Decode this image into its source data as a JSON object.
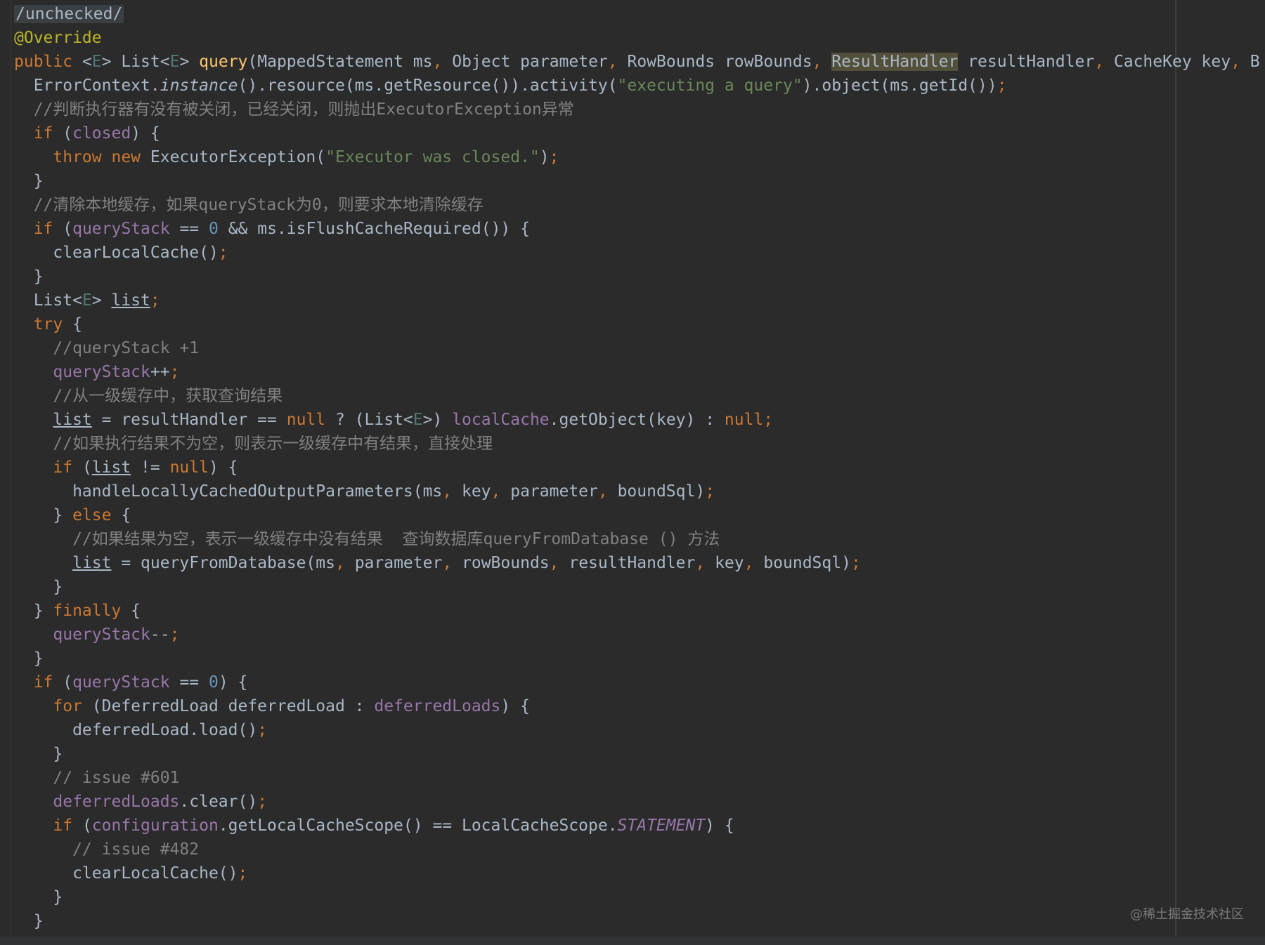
{
  "editor": {
    "watermark": "@稀土掘金技术社区",
    "colors": {
      "background": "#2b2b2b",
      "keyword": "#cc7832",
      "annotation": "#bbb529",
      "string": "#6a8759",
      "number": "#6897bb",
      "comment": "#808080",
      "field": "#9876aa",
      "method": "#ffc66d",
      "plain": "#a9b7c6"
    },
    "lines": [
      [
        {
          "t": "/unchecked/",
          "c": "deco-box"
        }
      ],
      [
        {
          "t": "@Override",
          "c": "ann"
        }
      ],
      [
        {
          "t": "public ",
          "c": "kw"
        },
        {
          "t": "<",
          "c": "plain"
        },
        {
          "t": "E",
          "c": "gen"
        },
        {
          "t": "> List<",
          "c": "plain"
        },
        {
          "t": "E",
          "c": "gen"
        },
        {
          "t": "> ",
          "c": "plain"
        },
        {
          "t": "query",
          "c": "mth"
        },
        {
          "t": "(MappedStatement ms",
          "c": "plain"
        },
        {
          "t": ", ",
          "c": "kw"
        },
        {
          "t": "Object parameter",
          "c": "plain"
        },
        {
          "t": ", ",
          "c": "kw"
        },
        {
          "t": "RowBounds rowBounds",
          "c": "plain"
        },
        {
          "t": ", ",
          "c": "kw"
        },
        {
          "t": "ResultHandler",
          "c": "plain hl"
        },
        {
          "t": " resultHandler",
          "c": "plain"
        },
        {
          "t": ", ",
          "c": "kw"
        },
        {
          "t": "CacheKey key",
          "c": "plain"
        },
        {
          "t": ", ",
          "c": "kw"
        },
        {
          "t": "B",
          "c": "plain"
        }
      ],
      [
        {
          "t": "  ErrorContext.",
          "c": "plain"
        },
        {
          "t": "instance",
          "c": "plain it"
        },
        {
          "t": "().resource(ms.getResource()).activity(",
          "c": "plain"
        },
        {
          "t": "\"executing a query\"",
          "c": "str"
        },
        {
          "t": ").object(ms.getId())",
          "c": "plain"
        },
        {
          "t": ";",
          "c": "kw"
        }
      ],
      [
        {
          "t": "  //判断执行器有没有被关闭，已经关闭，则抛出ExecutorException异常",
          "c": "cmt"
        }
      ],
      [
        {
          "t": "  if ",
          "c": "kw"
        },
        {
          "t": "(",
          "c": "plain"
        },
        {
          "t": "closed",
          "c": "fld"
        },
        {
          "t": ") {",
          "c": "plain"
        }
      ],
      [
        {
          "t": "    throw new ",
          "c": "kw"
        },
        {
          "t": "ExecutorException(",
          "c": "plain"
        },
        {
          "t": "\"Executor was closed.\"",
          "c": "str"
        },
        {
          "t": ")",
          "c": "plain"
        },
        {
          "t": ";",
          "c": "kw"
        }
      ],
      [
        {
          "t": "  }",
          "c": "plain"
        }
      ],
      [
        {
          "t": "  //清除本地缓存，如果queryStack为0，则要求本地清除缓存",
          "c": "cmt"
        }
      ],
      [
        {
          "t": "  if ",
          "c": "kw"
        },
        {
          "t": "(",
          "c": "plain"
        },
        {
          "t": "queryStack",
          "c": "fld"
        },
        {
          "t": " == ",
          "c": "plain"
        },
        {
          "t": "0",
          "c": "num"
        },
        {
          "t": " && ms.isFlushCacheRequired()) {",
          "c": "plain"
        }
      ],
      [
        {
          "t": "    clearLocalCache()",
          "c": "plain"
        },
        {
          "t": ";",
          "c": "kw"
        }
      ],
      [
        {
          "t": "  }",
          "c": "plain"
        }
      ],
      [
        {
          "t": "  List<",
          "c": "plain"
        },
        {
          "t": "E",
          "c": "gen"
        },
        {
          "t": "> ",
          "c": "plain"
        },
        {
          "t": "list",
          "c": "plain ul"
        },
        {
          "t": ";",
          "c": "kw"
        }
      ],
      [
        {
          "t": "  try ",
          "c": "kw"
        },
        {
          "t": "{",
          "c": "plain"
        }
      ],
      [
        {
          "t": "    //queryStack +1",
          "c": "cmt"
        }
      ],
      [
        {
          "t": "    queryStack",
          "c": "fld"
        },
        {
          "t": "++",
          "c": "plain"
        },
        {
          "t": ";",
          "c": "kw"
        }
      ],
      [
        {
          "t": "    //从一级缓存中，获取查询结果",
          "c": "cmt"
        }
      ],
      [
        {
          "t": "    ",
          "c": "plain"
        },
        {
          "t": "list",
          "c": "plain ul"
        },
        {
          "t": " = resultHandler == ",
          "c": "plain"
        },
        {
          "t": "null ",
          "c": "kw"
        },
        {
          "t": "? (List<",
          "c": "plain"
        },
        {
          "t": "E",
          "c": "gen"
        },
        {
          "t": ">) ",
          "c": "plain"
        },
        {
          "t": "localCache",
          "c": "fld"
        },
        {
          "t": ".getObject(key) : ",
          "c": "plain"
        },
        {
          "t": "null;",
          "c": "kw"
        }
      ],
      [
        {
          "t": "    //如果执行结果不为空，则表示一级缓存中有结果，直接处理",
          "c": "cmt"
        }
      ],
      [
        {
          "t": "    if ",
          "c": "kw"
        },
        {
          "t": "(",
          "c": "plain"
        },
        {
          "t": "list",
          "c": "plain ul"
        },
        {
          "t": " != ",
          "c": "plain"
        },
        {
          "t": "null",
          "c": "kw"
        },
        {
          "t": ") {",
          "c": "plain"
        }
      ],
      [
        {
          "t": "      handleLocallyCachedOutputParameters(ms",
          "c": "plain"
        },
        {
          "t": ", ",
          "c": "kw"
        },
        {
          "t": "key",
          "c": "plain"
        },
        {
          "t": ", ",
          "c": "kw"
        },
        {
          "t": "parameter",
          "c": "plain"
        },
        {
          "t": ", ",
          "c": "kw"
        },
        {
          "t": "boundSql)",
          "c": "plain"
        },
        {
          "t": ";",
          "c": "kw"
        }
      ],
      [
        {
          "t": "    } ",
          "c": "plain"
        },
        {
          "t": "else ",
          "c": "kw"
        },
        {
          "t": "{",
          "c": "plain"
        }
      ],
      [
        {
          "t": "      //如果结果为空，表示一级缓存中没有结果  查询数据库queryFromDatabase () 方法",
          "c": "cmt"
        }
      ],
      [
        {
          "t": "      ",
          "c": "plain"
        },
        {
          "t": "list",
          "c": "plain ul"
        },
        {
          "t": " = queryFromDatabase(ms",
          "c": "plain"
        },
        {
          "t": ", ",
          "c": "kw"
        },
        {
          "t": "parameter",
          "c": "plain"
        },
        {
          "t": ", ",
          "c": "kw"
        },
        {
          "t": "rowBounds",
          "c": "plain"
        },
        {
          "t": ", ",
          "c": "kw"
        },
        {
          "t": "resultHandler",
          "c": "plain"
        },
        {
          "t": ", ",
          "c": "kw"
        },
        {
          "t": "key",
          "c": "plain"
        },
        {
          "t": ", ",
          "c": "kw"
        },
        {
          "t": "boundSql)",
          "c": "plain"
        },
        {
          "t": ";",
          "c": "kw"
        }
      ],
      [
        {
          "t": "    }",
          "c": "plain"
        }
      ],
      [
        {
          "t": "  } ",
          "c": "plain"
        },
        {
          "t": "finally ",
          "c": "kw"
        },
        {
          "t": "{",
          "c": "plain"
        }
      ],
      [
        {
          "t": "    queryStack",
          "c": "fld"
        },
        {
          "t": "--",
          "c": "plain"
        },
        {
          "t": ";",
          "c": "kw"
        }
      ],
      [
        {
          "t": "  }",
          "c": "plain"
        }
      ],
      [
        {
          "t": "  if ",
          "c": "kw"
        },
        {
          "t": "(",
          "c": "plain"
        },
        {
          "t": "queryStack",
          "c": "fld"
        },
        {
          "t": " == ",
          "c": "plain"
        },
        {
          "t": "0",
          "c": "num"
        },
        {
          "t": ") {",
          "c": "plain"
        }
      ],
      [
        {
          "t": "    for ",
          "c": "kw"
        },
        {
          "t": "(DeferredLoad deferredLoad : ",
          "c": "plain"
        },
        {
          "t": "deferredLoads",
          "c": "fld"
        },
        {
          "t": ") {",
          "c": "plain"
        }
      ],
      [
        {
          "t": "      deferredLoad.load()",
          "c": "plain"
        },
        {
          "t": ";",
          "c": "kw"
        }
      ],
      [
        {
          "t": "    }",
          "c": "plain"
        }
      ],
      [
        {
          "t": "    // issue #601",
          "c": "cmt"
        }
      ],
      [
        {
          "t": "    deferredLoads",
          "c": "fld"
        },
        {
          "t": ".clear()",
          "c": "plain"
        },
        {
          "t": ";",
          "c": "kw"
        }
      ],
      [
        {
          "t": "    if ",
          "c": "kw"
        },
        {
          "t": "(",
          "c": "plain"
        },
        {
          "t": "configuration",
          "c": "fld"
        },
        {
          "t": ".getLocalCacheScope() == LocalCacheScope.",
          "c": "plain"
        },
        {
          "t": "STATEMENT",
          "c": "fld-i"
        },
        {
          "t": ") {",
          "c": "plain"
        }
      ],
      [
        {
          "t": "      // issue #482",
          "c": "cmt"
        }
      ],
      [
        {
          "t": "      clearLocalCache()",
          "c": "plain"
        },
        {
          "t": ";",
          "c": "kw"
        }
      ],
      [
        {
          "t": "    }",
          "c": "plain"
        }
      ],
      [
        {
          "t": "  }",
          "c": "plain"
        }
      ]
    ]
  }
}
